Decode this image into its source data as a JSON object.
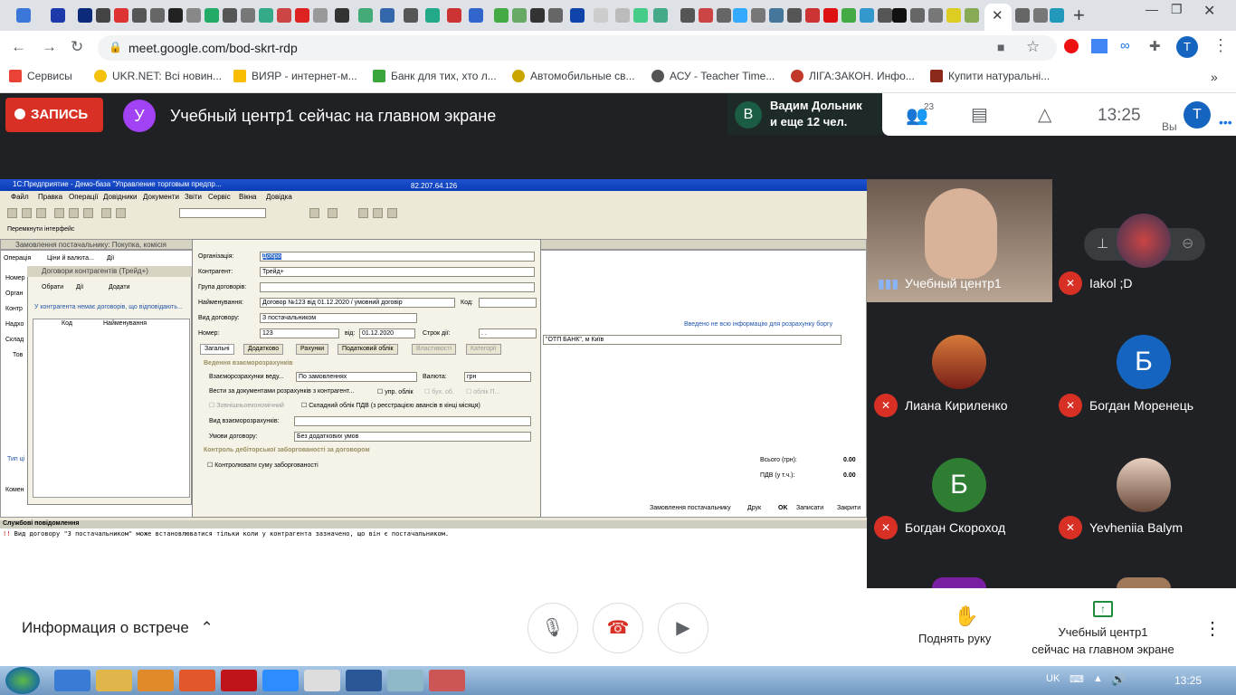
{
  "browser": {
    "tab_close": "✕",
    "new_tab": "+",
    "url": "meet.google.com/bod-skrt-rdp",
    "profile_initial": "T"
  },
  "bookmarks": [
    "Сервисы",
    "UKR.NET: Всі новин...",
    "ВИЯР - интернет-м...",
    "Банк для тих, хто л...",
    "Автомобильные св...",
    "АСУ - Teacher Time...",
    "ЛІГА:ЗАКОН. Инфо...",
    "Купити натуральні..."
  ],
  "meet": {
    "record_label": "ЗАПИСЬ",
    "presenter_initial": "У",
    "presenting_text": "Учебный центр1 сейчас на главном экране",
    "speaker_initial": "В",
    "speaker_line1": "Вадим Дольник",
    "speaker_line2": "и еще 12 чел.",
    "participant_count": "23",
    "clock": "13:25",
    "you_label": "Вы",
    "you_initial": "T"
  },
  "shared_screen": {
    "title": "1С:Предприятие - Демо-база \"Управление торговым предпр...",
    "ip": "82.207.64.126",
    "menu": [
      "Файл",
      "Правка",
      "Операції",
      "Довідники",
      "Документи",
      "Звіти",
      "Сервіс",
      "Вікна",
      "Довідка"
    ],
    "interface_switch": "Перемкнути інтерфейс",
    "order_window_title": "Замовлення постачальнику: Покупка, комісія",
    "order_toolbar": [
      "Операція",
      "Ціни й валюта...",
      "Дії"
    ],
    "contracts_title": "Договори контрагентів (Трейд+)",
    "contracts_toolbar": [
      "Обрати",
      "Дії",
      "Додати"
    ],
    "contracts_note": "У контрагента немає договорів, що відповідають...",
    "contracts_cols": [
      "Код",
      "Найменування"
    ],
    "dialog": {
      "org_label": "Організація:",
      "org_value": "Добро",
      "counterparty_label": "Контрагент:",
      "counterparty_value": "Трейд+",
      "group_label": "Група договорів:",
      "name_label": "Найменування:",
      "name_value": "Договор №123 від 01.12.2020 / умовний договір",
      "code_label": "Код:",
      "type_label": "Вид договору:",
      "type_value": "З постачальником",
      "number_label": "Номер:",
      "number_value": "123",
      "from_label": "від:",
      "date_value": "01.12.2020",
      "term_label": "Строк дії:",
      "term_value": ". .",
      "tabs": [
        "Загальні",
        "Додатково",
        "Рахунки",
        "Податковий облік",
        "Властивості",
        "Категорії"
      ],
      "settlements_header": "Ведення взаєморозрахунків",
      "settle_by_label": "Взаєморозрахунки веду...",
      "settle_by_value": "По замовленнях",
      "currency_label": "Валюта:",
      "currency_value": "грн",
      "docs_label": "Вести за документами розрахунків з контрагент...",
      "check1": "упр. облік",
      "check2": "бух. об.",
      "check3": "облік П...",
      "foreign_label": "Зовнішньоекономічний",
      "vat_label": "Складний облік ПДВ (з реєстрацією авансів в кінці місяця)",
      "kind_label": "Вид взаєморозрахунків:",
      "terms_label": "Умови договору:",
      "terms_value": "Без додаткових умов",
      "debt_header": "Контроль дебіторської заборгованості за договором",
      "debt_check": "Контролювати суму заборгованості"
    },
    "right_info": "Введено не всю інформацію для розрахунку боргу",
    "bank": "\"ОТП БАНК\", м Київ",
    "total_label": "Всього (грн):",
    "total_value": "0.00",
    "vat_total_label": "ПДВ (у т.ч.):",
    "vat_total_value": "0.00",
    "bottom_buttons": [
      "Замовлення постачальнику",
      "Друк",
      "OK",
      "Записати",
      "Закрити"
    ],
    "left_labels": [
      "Номер",
      "Орган",
      "Контр",
      "Надхо",
      "Склад",
      "Тов",
      "Тип ці",
      "Комен"
    ],
    "messages_title": "Службові повідомлення",
    "message": "Вид договору \"З постачальником\" може встановлюватися тільки коли у контрагента зазначено, що він є постачальником."
  },
  "participants": [
    {
      "name": "Учебный центр1",
      "initial": "",
      "muted": false
    },
    {
      "name": "Iakol ;D",
      "initial": "",
      "muted": true
    },
    {
      "name": "Лиана Кириленко",
      "initial": "",
      "muted": true
    },
    {
      "name": "Богдан Моренець",
      "initial": "Б",
      "muted": true
    },
    {
      "name": "Богдан Скороход",
      "initial": "Б",
      "muted": true
    },
    {
      "name": "Yevheniia Balym",
      "initial": "",
      "muted": true
    }
  ],
  "bottom": {
    "info_label": "Информация о встрече",
    "raise_hand_label": "Поднять руку",
    "presenting_line1": "Учебный центр1",
    "presenting_line2": "сейчас на главном экране"
  },
  "taskbar": {
    "lang": "UK",
    "time": "13:25"
  },
  "colors": {
    "record_red": "#d93025",
    "meet_dark": "#202124",
    "presenter_purple": "#a142f4",
    "blue_avatar": "#1565c0",
    "green_avatar": "#2e7d32"
  }
}
